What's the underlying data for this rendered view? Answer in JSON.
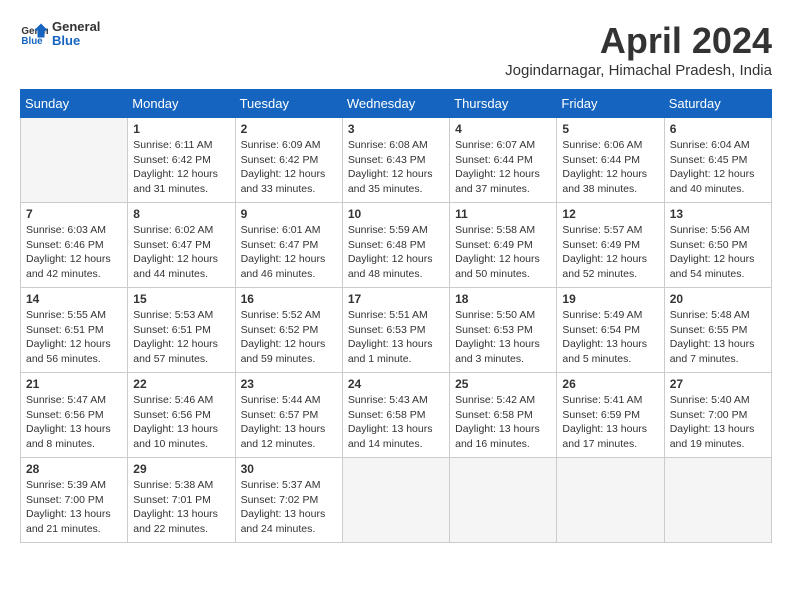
{
  "header": {
    "logo_line1": "General",
    "logo_line2": "Blue",
    "month_title": "April 2024",
    "location": "Jogindarnagar, Himachal Pradesh, India"
  },
  "weekdays": [
    "Sunday",
    "Monday",
    "Tuesday",
    "Wednesday",
    "Thursday",
    "Friday",
    "Saturday"
  ],
  "weeks": [
    [
      {
        "day": "",
        "info": ""
      },
      {
        "day": "1",
        "info": "Sunrise: 6:11 AM\nSunset: 6:42 PM\nDaylight: 12 hours\nand 31 minutes."
      },
      {
        "day": "2",
        "info": "Sunrise: 6:09 AM\nSunset: 6:42 PM\nDaylight: 12 hours\nand 33 minutes."
      },
      {
        "day": "3",
        "info": "Sunrise: 6:08 AM\nSunset: 6:43 PM\nDaylight: 12 hours\nand 35 minutes."
      },
      {
        "day": "4",
        "info": "Sunrise: 6:07 AM\nSunset: 6:44 PM\nDaylight: 12 hours\nand 37 minutes."
      },
      {
        "day": "5",
        "info": "Sunrise: 6:06 AM\nSunset: 6:44 PM\nDaylight: 12 hours\nand 38 minutes."
      },
      {
        "day": "6",
        "info": "Sunrise: 6:04 AM\nSunset: 6:45 PM\nDaylight: 12 hours\nand 40 minutes."
      }
    ],
    [
      {
        "day": "7",
        "info": "Sunrise: 6:03 AM\nSunset: 6:46 PM\nDaylight: 12 hours\nand 42 minutes."
      },
      {
        "day": "8",
        "info": "Sunrise: 6:02 AM\nSunset: 6:47 PM\nDaylight: 12 hours\nand 44 minutes."
      },
      {
        "day": "9",
        "info": "Sunrise: 6:01 AM\nSunset: 6:47 PM\nDaylight: 12 hours\nand 46 minutes."
      },
      {
        "day": "10",
        "info": "Sunrise: 5:59 AM\nSunset: 6:48 PM\nDaylight: 12 hours\nand 48 minutes."
      },
      {
        "day": "11",
        "info": "Sunrise: 5:58 AM\nSunset: 6:49 PM\nDaylight: 12 hours\nand 50 minutes."
      },
      {
        "day": "12",
        "info": "Sunrise: 5:57 AM\nSunset: 6:49 PM\nDaylight: 12 hours\nand 52 minutes."
      },
      {
        "day": "13",
        "info": "Sunrise: 5:56 AM\nSunset: 6:50 PM\nDaylight: 12 hours\nand 54 minutes."
      }
    ],
    [
      {
        "day": "14",
        "info": "Sunrise: 5:55 AM\nSunset: 6:51 PM\nDaylight: 12 hours\nand 56 minutes."
      },
      {
        "day": "15",
        "info": "Sunrise: 5:53 AM\nSunset: 6:51 PM\nDaylight: 12 hours\nand 57 minutes."
      },
      {
        "day": "16",
        "info": "Sunrise: 5:52 AM\nSunset: 6:52 PM\nDaylight: 12 hours\nand 59 minutes."
      },
      {
        "day": "17",
        "info": "Sunrise: 5:51 AM\nSunset: 6:53 PM\nDaylight: 13 hours\nand 1 minute."
      },
      {
        "day": "18",
        "info": "Sunrise: 5:50 AM\nSunset: 6:53 PM\nDaylight: 13 hours\nand 3 minutes."
      },
      {
        "day": "19",
        "info": "Sunrise: 5:49 AM\nSunset: 6:54 PM\nDaylight: 13 hours\nand 5 minutes."
      },
      {
        "day": "20",
        "info": "Sunrise: 5:48 AM\nSunset: 6:55 PM\nDaylight: 13 hours\nand 7 minutes."
      }
    ],
    [
      {
        "day": "21",
        "info": "Sunrise: 5:47 AM\nSunset: 6:56 PM\nDaylight: 13 hours\nand 8 minutes."
      },
      {
        "day": "22",
        "info": "Sunrise: 5:46 AM\nSunset: 6:56 PM\nDaylight: 13 hours\nand 10 minutes."
      },
      {
        "day": "23",
        "info": "Sunrise: 5:44 AM\nSunset: 6:57 PM\nDaylight: 13 hours\nand 12 minutes."
      },
      {
        "day": "24",
        "info": "Sunrise: 5:43 AM\nSunset: 6:58 PM\nDaylight: 13 hours\nand 14 minutes."
      },
      {
        "day": "25",
        "info": "Sunrise: 5:42 AM\nSunset: 6:58 PM\nDaylight: 13 hours\nand 16 minutes."
      },
      {
        "day": "26",
        "info": "Sunrise: 5:41 AM\nSunset: 6:59 PM\nDaylight: 13 hours\nand 17 minutes."
      },
      {
        "day": "27",
        "info": "Sunrise: 5:40 AM\nSunset: 7:00 PM\nDaylight: 13 hours\nand 19 minutes."
      }
    ],
    [
      {
        "day": "28",
        "info": "Sunrise: 5:39 AM\nSunset: 7:00 PM\nDaylight: 13 hours\nand 21 minutes."
      },
      {
        "day": "29",
        "info": "Sunrise: 5:38 AM\nSunset: 7:01 PM\nDaylight: 13 hours\nand 22 minutes."
      },
      {
        "day": "30",
        "info": "Sunrise: 5:37 AM\nSunset: 7:02 PM\nDaylight: 13 hours\nand 24 minutes."
      },
      {
        "day": "",
        "info": ""
      },
      {
        "day": "",
        "info": ""
      },
      {
        "day": "",
        "info": ""
      },
      {
        "day": "",
        "info": ""
      }
    ]
  ]
}
